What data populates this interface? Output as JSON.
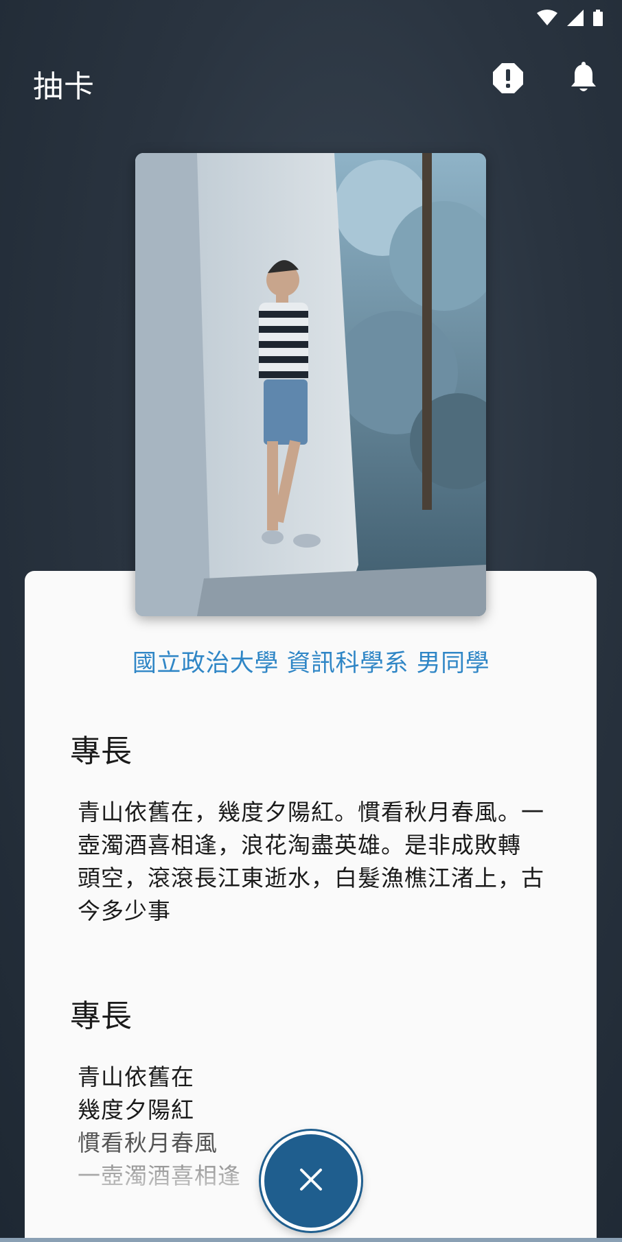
{
  "app_bar": {
    "title": "抽卡",
    "report_icon": "alert-octagon-icon",
    "notify_icon": "bell-icon"
  },
  "status_bar": {
    "icons": [
      "wifi-icon",
      "cell-signal-icon",
      "battery-icon"
    ]
  },
  "card": {
    "photo_icon": "profile-photo",
    "school_line": "國立政治大學 資訊科學系 男同學",
    "sections": [
      {
        "title": "專長",
        "lines": [
          "青山依舊在，幾度夕陽紅。慣看秋月春風。一",
          "壺濁酒喜相逢，浪花淘盡英雄。是非成敗轉",
          "頭空，滾滾長江東逝水，白髮漁樵江渚上，古",
          "今多少事"
        ]
      },
      {
        "title": "專長",
        "lines": [
          "青山依舊在",
          "幾度夕陽紅",
          "慣看秋月春風",
          "一壺濁酒喜相逢"
        ]
      }
    ]
  },
  "close_button_icon": "close-icon",
  "colors": {
    "accent": "#2f86c6",
    "fab": "#1f5e8e",
    "background": "#2a3440",
    "card": "#fafafa"
  }
}
